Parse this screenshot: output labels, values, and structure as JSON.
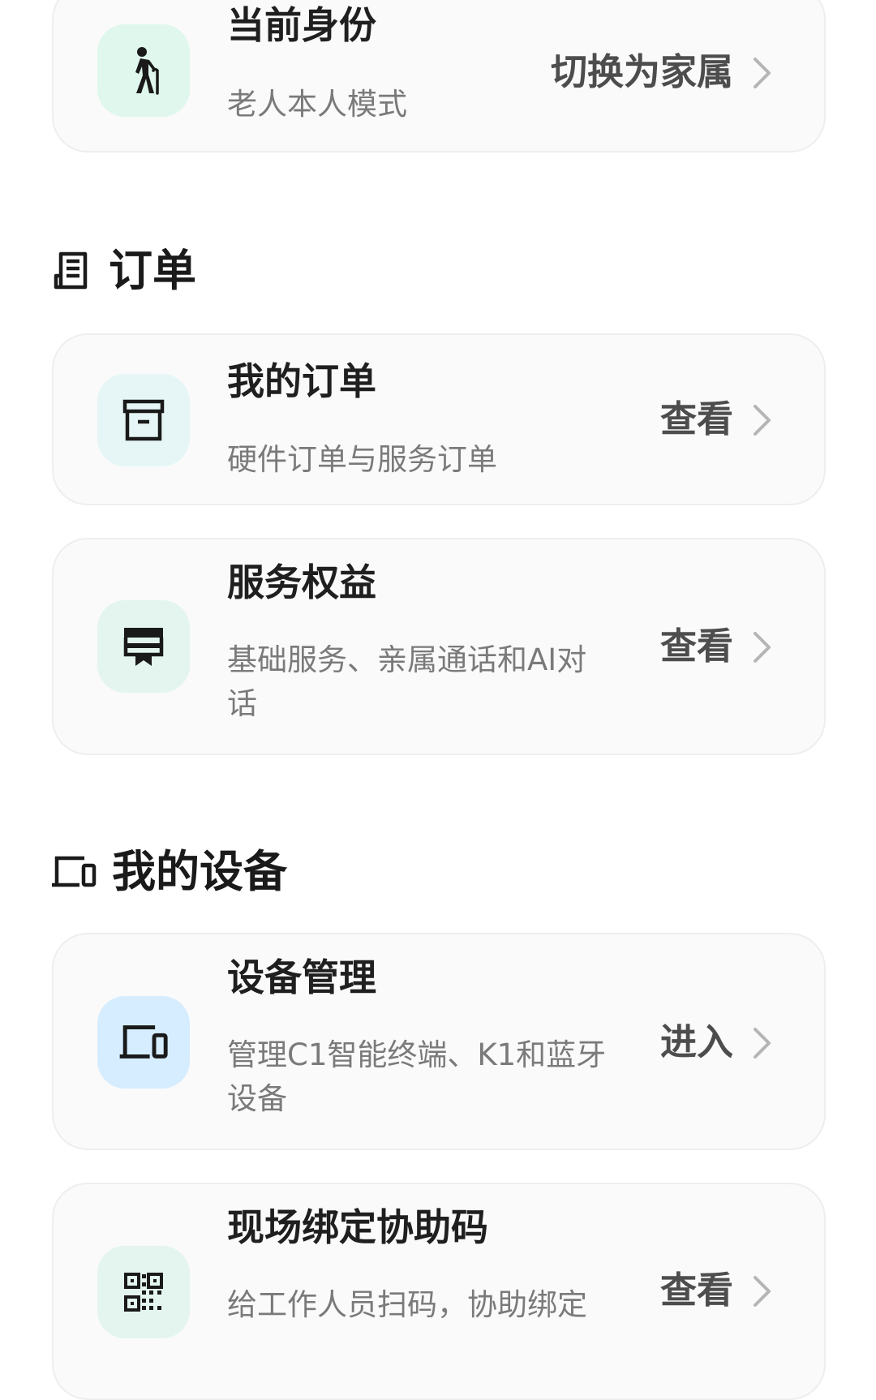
{
  "identity": {
    "title": "当前身份",
    "subtitle": "老人本人模式",
    "action": "切换为家属",
    "icon": "elderly-person-icon",
    "icon_bg": "#dff7ec"
  },
  "orders_section": {
    "title": "订单",
    "icon": "receipt-icon",
    "items": [
      {
        "title": "我的订单",
        "subtitle": "硬件订单与服务订单",
        "action": "查看",
        "icon": "archive-box-icon",
        "icon_bg": "#e6f6f6"
      },
      {
        "title": "服务权益",
        "subtitle": "基础服务、亲属通话和AI对话",
        "action": "查看",
        "icon": "ticket-icon",
        "icon_bg": "#e3f5ee"
      }
    ]
  },
  "devices_section": {
    "title": "我的设备",
    "icon": "devices-icon",
    "items": [
      {
        "title": "设备管理",
        "subtitle": "管理C1智能终端、K1和蓝牙设备",
        "action": "进入",
        "icon": "devices-icon",
        "icon_bg": "#d6edff"
      },
      {
        "title": "现场绑定协助码",
        "subtitle": "给工作人员扫码，协助绑定",
        "action": "查看",
        "icon": "qr-code-icon",
        "icon_bg": "#e3f5ee"
      }
    ]
  },
  "colors": {
    "card_bg": "#fafafa",
    "card_border": "#eeeeee",
    "title_text": "#1f1f1f",
    "subtitle_text": "#7a7a7a",
    "action_text": "#4d4d4d",
    "chevron": "#b5b5b5"
  }
}
